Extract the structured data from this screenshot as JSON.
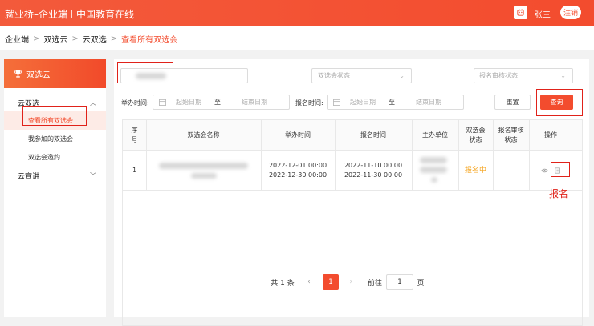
{
  "topbar": {
    "brand": "就业桥–企业端",
    "org": "中国教育在线",
    "user": "张三",
    "logout": "注销"
  },
  "breadcrumb": [
    "企业端",
    "双选云",
    "云双选",
    "查看所有双选会"
  ],
  "sidebar": {
    "title": "双选云",
    "groups": [
      {
        "label": "云双选",
        "expanded": true,
        "items": [
          "查看所有双选会",
          "我参加的双选会",
          "双选会邀约"
        ]
      },
      {
        "label": "云宣讲",
        "expanded": false,
        "items": []
      }
    ]
  },
  "filters": {
    "status_placeholder": "双选会状态",
    "review_placeholder": "报名审核状态",
    "hold_label": "举办时间:",
    "signup_label": "报名时间:",
    "start_placeholder": "起始日期",
    "to": "至",
    "end_placeholder": "结束日期",
    "reset": "重置",
    "query": "查询"
  },
  "table": {
    "headers": [
      "序号",
      "双选会名称",
      "举办时间",
      "报名时间",
      "主办单位",
      "双选会状态",
      "报名审核状态",
      "操作"
    ],
    "rows": [
      {
        "index": "1",
        "hold_start": "2022-12-01 00:00",
        "hold_end": "2022-12-30 00:00",
        "signup_start": "2022-11-10 00:00",
        "signup_end": "2022-11-30 00:00",
        "status": "报名中",
        "review": ""
      }
    ]
  },
  "pagination": {
    "total": "共 1 条",
    "prev": "‹",
    "page": "1",
    "next": "›",
    "goto": "前往",
    "goto_value": "1",
    "page_unit": "页"
  },
  "annotation": "报名",
  "colors": {
    "brand": "#f34c2e",
    "status": "#f5a623",
    "annotation": "#e0221a"
  }
}
